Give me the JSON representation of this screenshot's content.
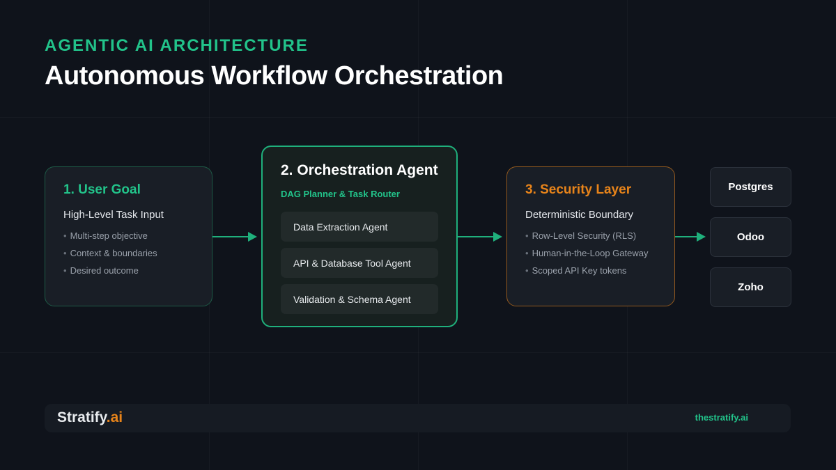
{
  "header": {
    "eyebrow": "AGENTIC AI ARCHITECTURE",
    "title": "Autonomous Workflow Orchestration"
  },
  "user_goal": {
    "title": "1. User Goal",
    "subtitle": "High-Level Task Input",
    "bullets": [
      "Multi-step objective",
      "Context & boundaries",
      "Desired outcome"
    ]
  },
  "orchestration": {
    "title": "2. Orchestration Agent",
    "subtitle": "DAG Planner & Task Router",
    "agents": [
      "Data Extraction Agent",
      "API & Database Tool Agent",
      "Validation & Schema Agent"
    ]
  },
  "security": {
    "title": "3. Security Layer",
    "subtitle": "Deterministic Boundary",
    "bullets": [
      "Row-Level Security (RLS)",
      "Human-in-the-Loop Gateway",
      "Scoped API Key tokens"
    ]
  },
  "targets": [
    "Postgres",
    "Odoo",
    "Zoho"
  ],
  "footer": {
    "brand_name": "Stratify",
    "brand_suffix": ".ai",
    "site": "thestratify.ai"
  },
  "colors": {
    "accent_green": "#22c38a",
    "accent_orange": "#e8841a",
    "background": "#0f131b"
  }
}
